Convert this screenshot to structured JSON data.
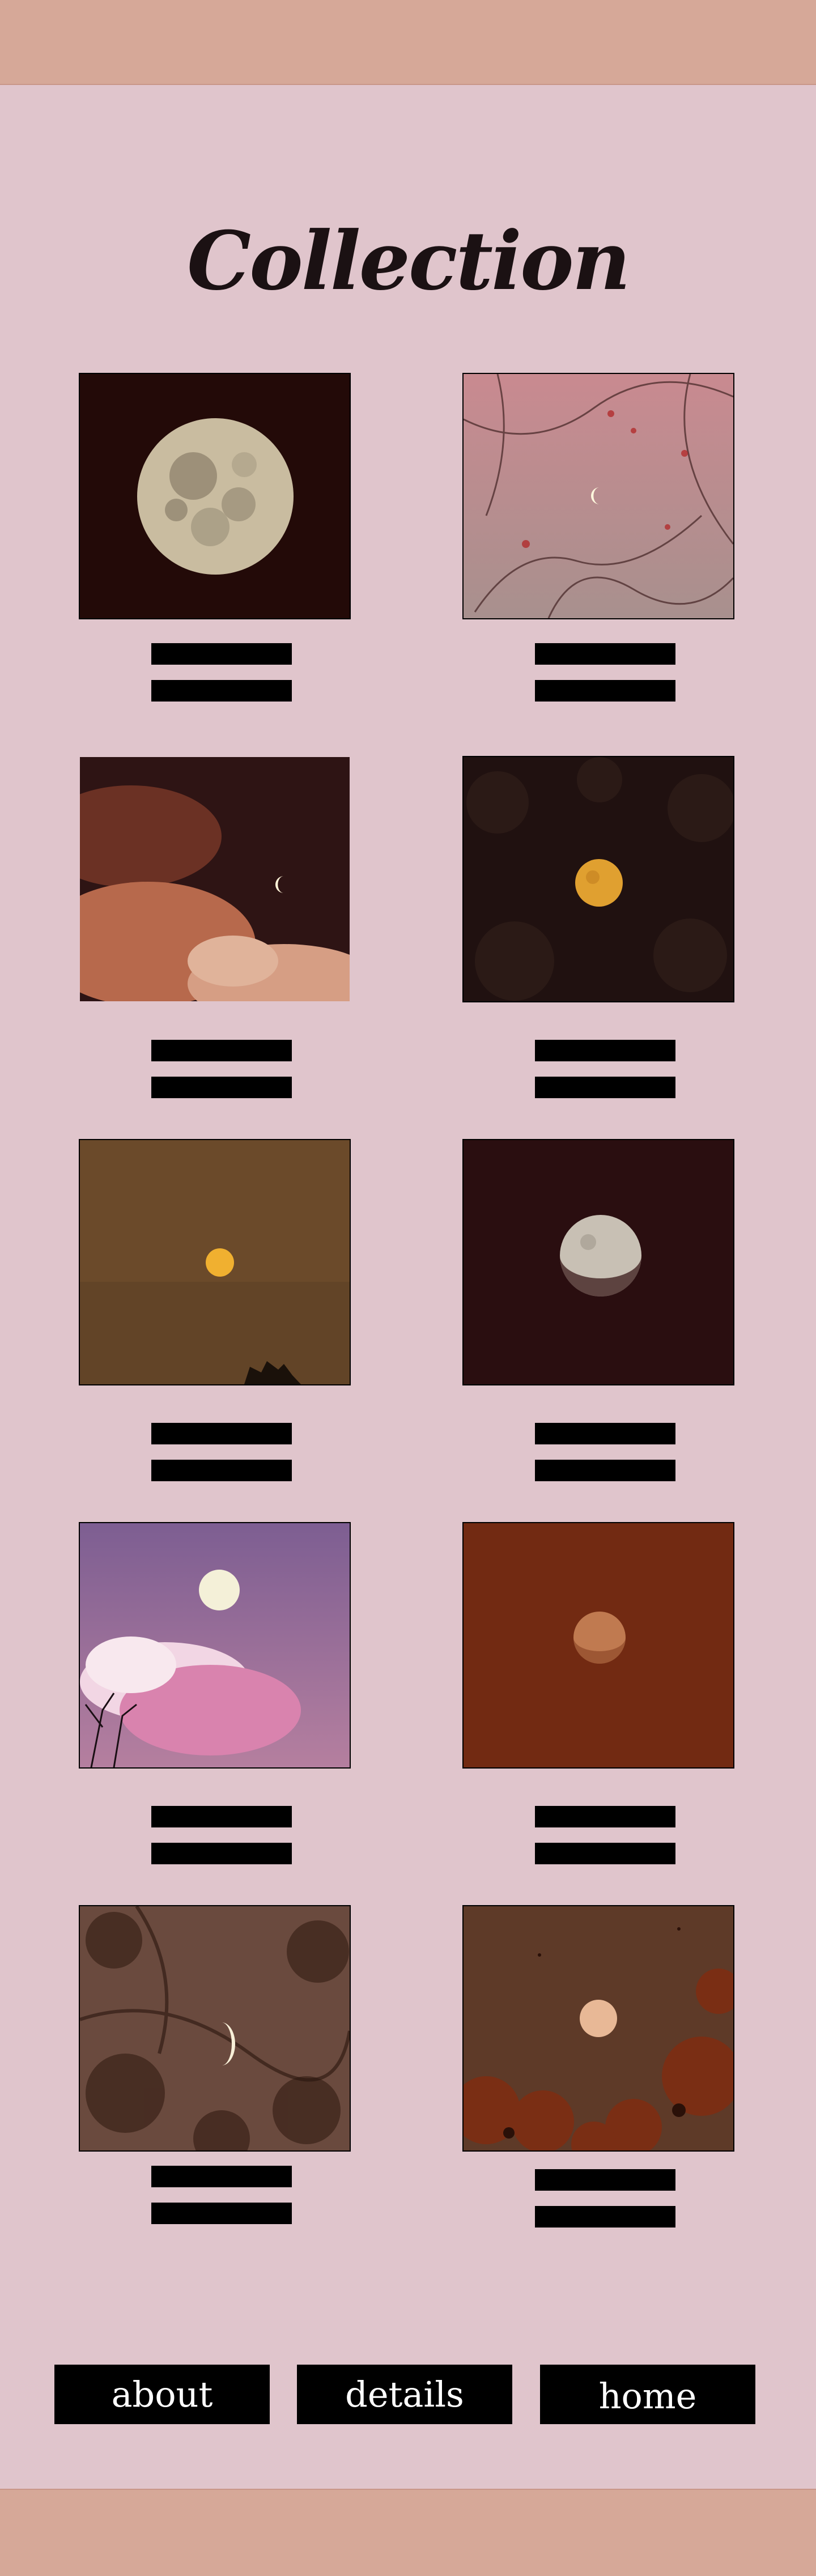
{
  "page": {
    "title": "Collection"
  },
  "gallery": {
    "items": [
      {
        "name": "full-moon-dark"
      },
      {
        "name": "crescent-moon-branches-pink"
      },
      {
        "name": "crescent-moon-clouds-dusk"
      },
      {
        "name": "golden-moon-through-leaves"
      },
      {
        "name": "golden-moon-sepia-sky"
      },
      {
        "name": "gibbous-moon-dark-red"
      },
      {
        "name": "full-moon-pink-cloud"
      },
      {
        "name": "moon-rust-sky"
      },
      {
        "name": "crescent-moon-blurred-branches"
      },
      {
        "name": "moon-over-trees-rust"
      }
    ]
  },
  "nav": {
    "about": "about",
    "details": "details",
    "home": "home"
  },
  "colors": {
    "background": "#e0c5cc",
    "band": "#d6a898",
    "button": "#000000",
    "button_text": "#ffffff"
  }
}
